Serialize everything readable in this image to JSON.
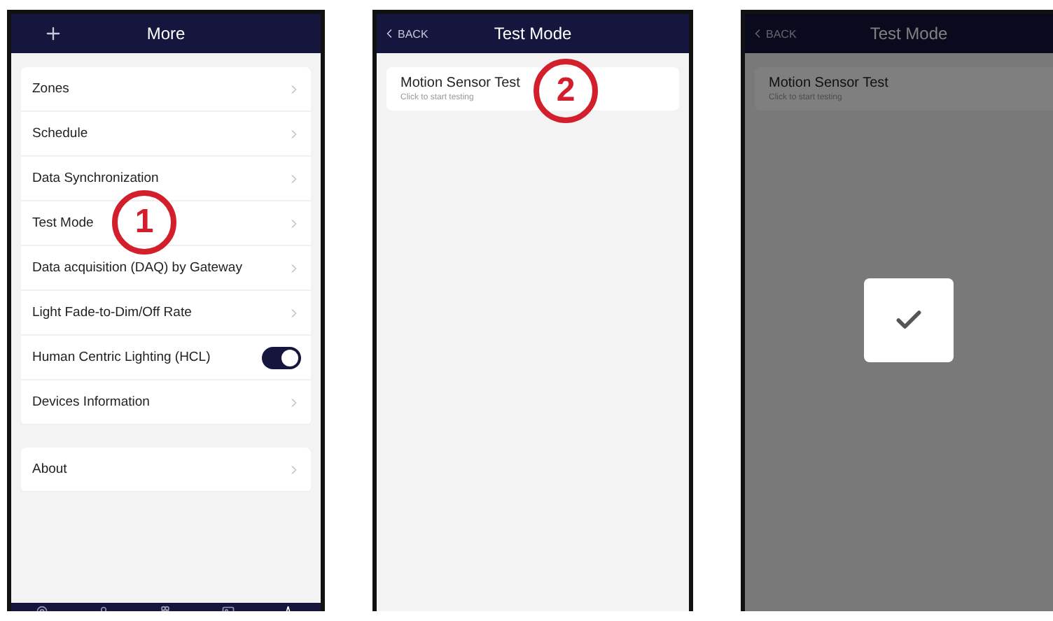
{
  "screens": [
    {
      "kind": "menu",
      "title": "More",
      "callout": "1",
      "sections": [
        [
          {
            "kind": "link",
            "label": "Zones"
          },
          {
            "kind": "link",
            "label": "Schedule"
          },
          {
            "kind": "link",
            "label": "Data Synchronization"
          },
          {
            "kind": "link",
            "label": "Test Mode"
          },
          {
            "kind": "link",
            "label": "Data acquisition (DAQ) by Gateway"
          },
          {
            "kind": "link",
            "label": "Light Fade-to-Dim/Off Rate"
          },
          {
            "kind": "toggle",
            "label": "Human Centric Lighting (HCL)",
            "on": true
          },
          {
            "kind": "link",
            "label": "Devices Information"
          }
        ],
        [
          {
            "kind": "link",
            "label": "About"
          }
        ]
      ],
      "tab_bar": [
        {
          "selected": false
        },
        {
          "selected": false
        },
        {
          "selected": false
        },
        {
          "selected": false
        },
        {
          "selected": true
        }
      ]
    },
    {
      "kind": "test",
      "back": "BACK",
      "title": "Test Mode",
      "callout": "2",
      "confirmation_shown": false,
      "items": [
        {
          "title": "Motion Sensor Test",
          "subtitle": "Click to start testing"
        }
      ]
    },
    {
      "kind": "test",
      "back": "BACK",
      "title": "Test Mode",
      "confirmation_shown": true,
      "items": [
        {
          "title": "Motion Sensor Test",
          "subtitle": "Click to start testing"
        }
      ]
    }
  ]
}
